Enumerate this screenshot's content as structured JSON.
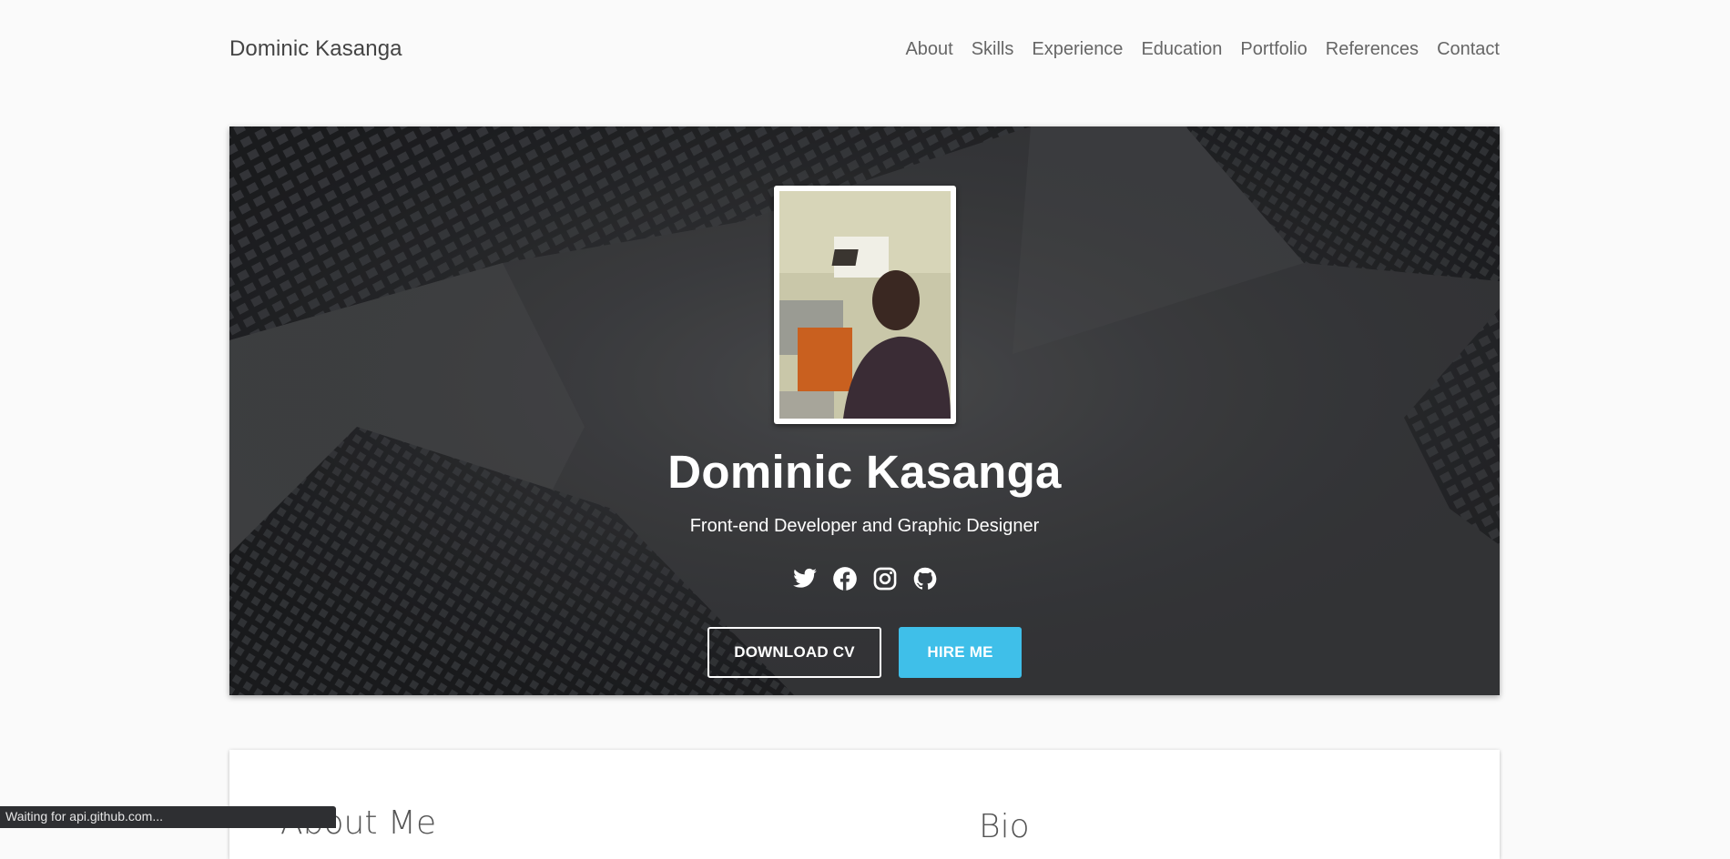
{
  "brand": "Dominic Kasanga",
  "nav": {
    "about": "About",
    "skills": "Skills",
    "experience": "Experience",
    "education": "Education",
    "portfolio": "Portfolio",
    "references": "References",
    "contact": "Contact"
  },
  "hero": {
    "name": "Dominic Kasanga",
    "tagline": "Front-end Developer and Graphic Designer",
    "social_icons": [
      "twitter-icon",
      "facebook-icon",
      "instagram-icon",
      "github-icon"
    ],
    "download_cv": "DOWNLOAD CV",
    "hire_me": "HIRE ME"
  },
  "sections": {
    "about_title": "About Me",
    "bio_title": "Bio"
  },
  "status_text": "Waiting for api.github.com...",
  "colors": {
    "accent": "#3fbfe9",
    "background": "#fafafa",
    "hero_overlay": "#3a3b3d"
  }
}
